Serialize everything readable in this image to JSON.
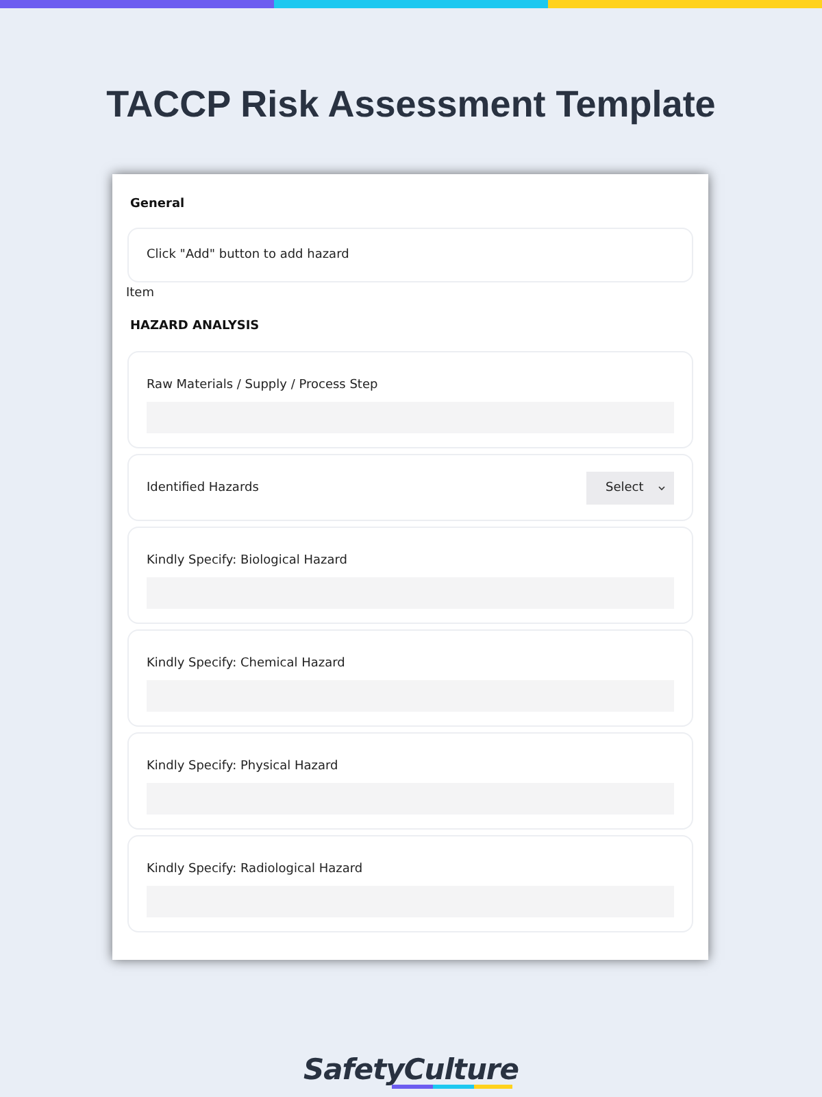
{
  "title": "TACCP Risk Assessment Template",
  "items": [
    {
      "kind": "heading",
      "text": "General"
    },
    {
      "kind": "note",
      "text": "Click \"Add\" button to add hazard"
    },
    {
      "kind": "caption",
      "text": "Item"
    },
    {
      "kind": "heading",
      "text": "HAZARD ANALYSIS"
    },
    {
      "kind": "input",
      "text": "Raw Materials / Supply / Process Step"
    },
    {
      "kind": "select",
      "text": "Identified Hazards",
      "value": "Select"
    },
    {
      "kind": "input",
      "text": "Kindly Specify: Biological Hazard"
    },
    {
      "kind": "input",
      "text": "Kindly Specify: Chemical Hazard"
    },
    {
      "kind": "input",
      "text": "Kindly Specify: Physical Hazard"
    },
    {
      "kind": "input",
      "text": "Kindly Specify: Radiological Hazard"
    }
  ],
  "logo": "SafetyCulture"
}
